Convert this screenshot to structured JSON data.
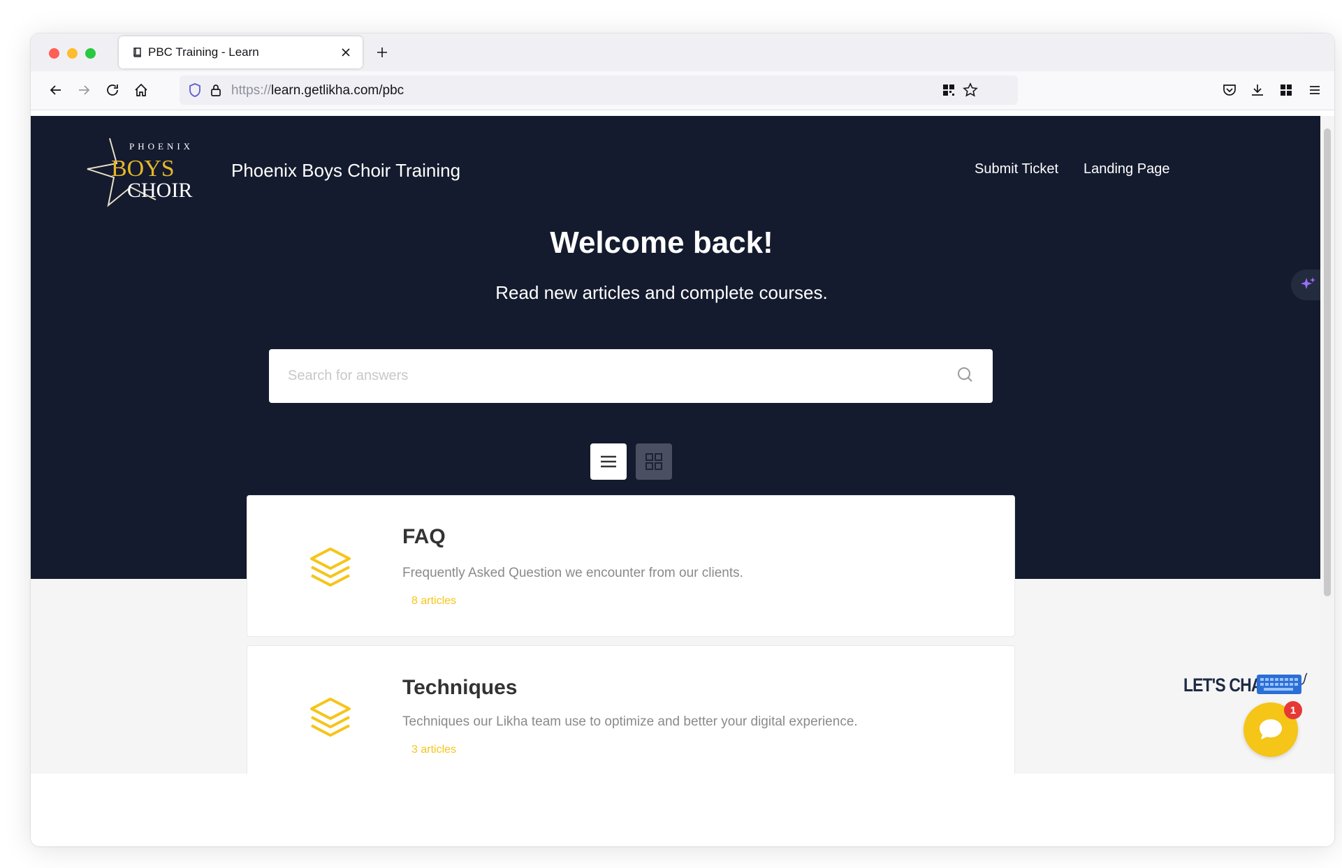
{
  "browser": {
    "tab_title": "PBC Training - Learn",
    "url_protocol": "https://",
    "url_rest": "learn.getlikha.com/pbc",
    "traffic_light_colors": [
      "#ff5f57",
      "#febc2e",
      "#28c840"
    ]
  },
  "site": {
    "logo_top_text": "PHOENIX",
    "logo_mid_text": "BOYS",
    "logo_bottom_text": "CHOIR",
    "title": "Phoenix Boys Choir Training",
    "nav": [
      "Submit Ticket",
      "Landing Page"
    ]
  },
  "hero": {
    "heading": "Welcome back!",
    "subheading": "Read new articles and complete courses.",
    "search_placeholder": "Search for answers"
  },
  "categories": [
    {
      "title": "FAQ",
      "description": "Frequently Asked Question we encounter from our clients.",
      "count": "8 articles"
    },
    {
      "title": "Techniques",
      "description": "Techniques our Likha team use to optimize and better your digital experience.",
      "count": "3 articles"
    }
  ],
  "chat": {
    "label": "LET'S CHAT",
    "badge": "1"
  },
  "colors": {
    "hero_bg": "#141b2e",
    "accent": "#f5c518",
    "badge": "#e53935"
  }
}
